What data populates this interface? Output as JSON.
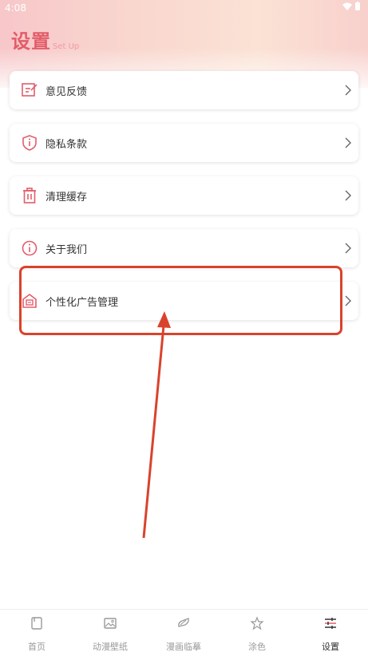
{
  "status_bar": {
    "time": "4:08"
  },
  "header": {
    "title": "设置",
    "subtitle": "Set Up"
  },
  "menu": {
    "items": [
      {
        "label": "意见反馈",
        "icon": "edit-icon"
      },
      {
        "label": "隐私条款",
        "icon": "shield-icon"
      },
      {
        "label": "清理缓存",
        "icon": "trash-icon"
      },
      {
        "label": "关于我们",
        "icon": "info-icon"
      },
      {
        "label": "个性化广告管理",
        "icon": "ad-icon"
      }
    ]
  },
  "bottom_nav": {
    "items": [
      {
        "label": "首页",
        "icon": "home-icon"
      },
      {
        "label": "动漫壁纸",
        "icon": "image-icon"
      },
      {
        "label": "漫画临摹",
        "icon": "brush-icon"
      },
      {
        "label": "涂色",
        "icon": "star-icon"
      },
      {
        "label": "设置",
        "icon": "settings-icon",
        "active": true
      }
    ]
  },
  "colors": {
    "accent": "#e35d6a",
    "annotation": "#d9432c"
  }
}
